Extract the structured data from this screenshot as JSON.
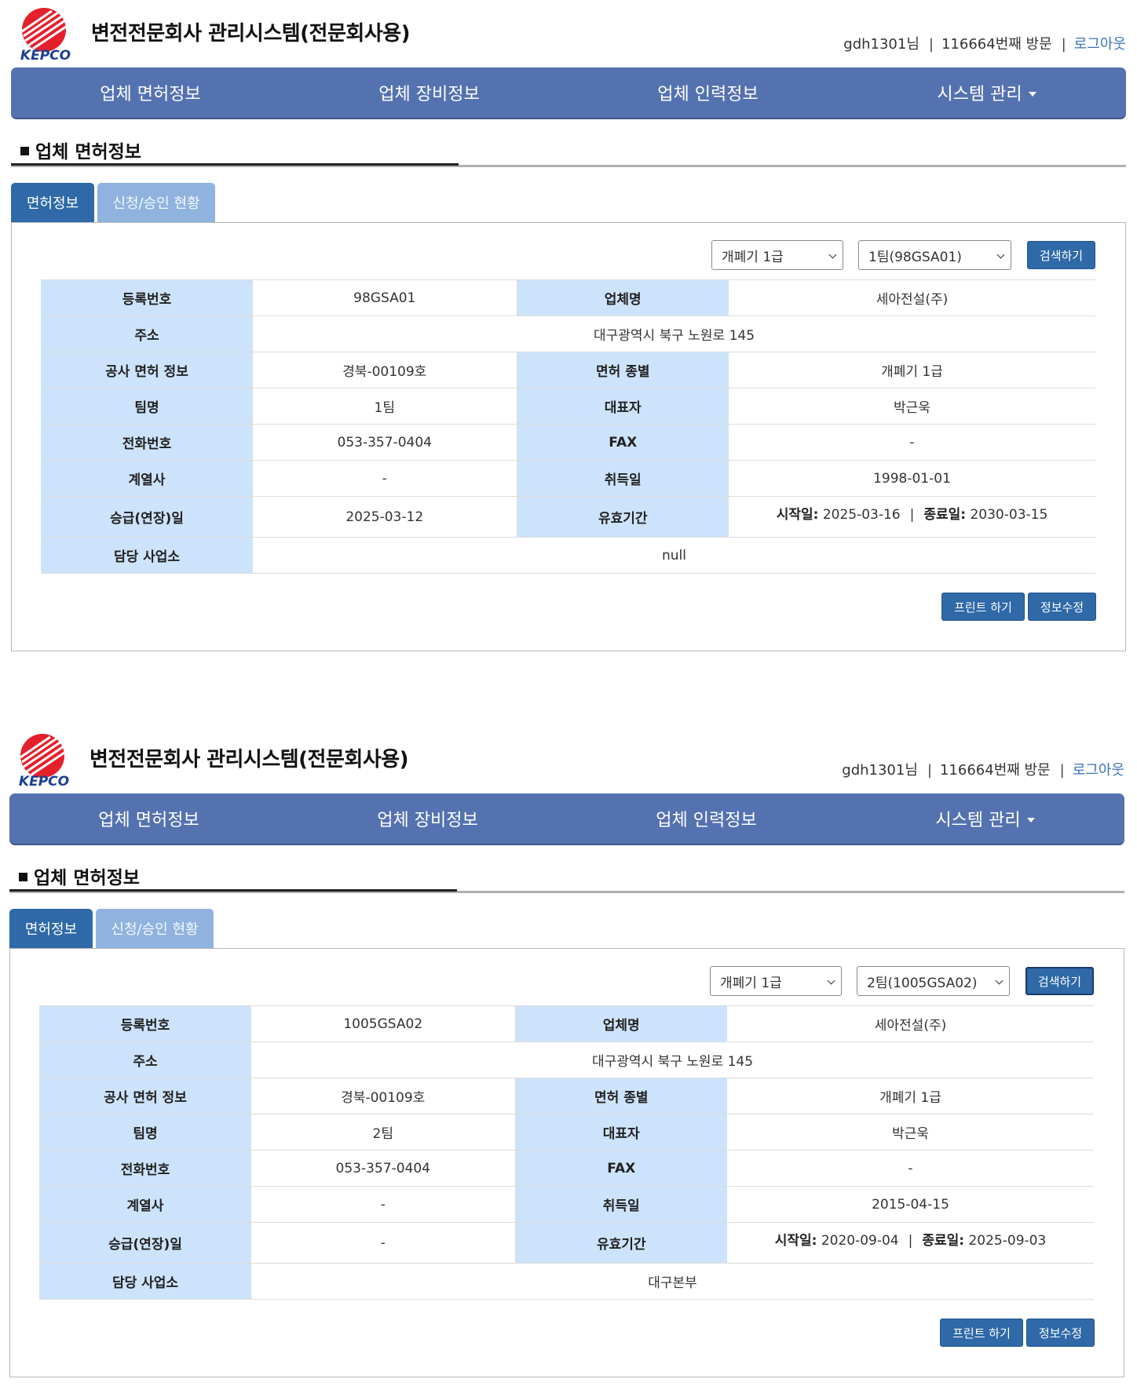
{
  "header": {
    "system_title": "변전전문회사 관리시스템(전문회사용)",
    "logo_text": "KEPCO",
    "user_name": "gdh1301님",
    "separator": "|",
    "visit_count": "116664번째 방문",
    "logout_label": "로그아웃"
  },
  "nav": {
    "items": [
      "업체 면허정보",
      "업체 장비정보",
      "업체 인력정보",
      "시스템 관리"
    ]
  },
  "section": {
    "title": "업체 면허정보"
  },
  "tabs": {
    "license": "면허정보",
    "status": "신청/승인 현황"
  },
  "buttons": {
    "search": "검색하기",
    "print": "프린트 하기",
    "edit": "정보수정"
  },
  "labels": {
    "reg_no": "등록번호",
    "company_name": "업체명",
    "address": "주소",
    "license_info": "공사 면허 정보",
    "license_type": "면허 종별",
    "team_name": "팀명",
    "ceo": "대표자",
    "phone": "전화번호",
    "fax": "FAX",
    "affiliate": "계열사",
    "acquire_date": "취득일",
    "promotion_date": "승급(연장)일",
    "validity": "유효기간",
    "office": "담당 사업소",
    "start_label": "시작일:",
    "end_label": "종료일:",
    "period_sep": "|"
  },
  "colors": {
    "nav": "#5572b0",
    "tab_active": "#2f69a8",
    "tab_inactive": "#8fb3de",
    "label_bg": "#cde3fb",
    "link": "#3a72b7"
  },
  "panels": [
    {
      "filter": {
        "grade": "개폐기 1급",
        "team": "1팀(98GSA01)"
      },
      "record": {
        "reg_no": "98GSA01",
        "company_name": "세아전설(주)",
        "address": "대구광역시 북구 노원로 145",
        "license_info": "경북-00109호",
        "license_type": "개폐기 1급",
        "team_name": "1팀",
        "ceo": "박근욱",
        "phone": "053-357-0404",
        "fax": "-",
        "affiliate": "-",
        "acquire_date": "1998-01-01",
        "promotion_date": "2025-03-12",
        "start_date": "2025-03-16",
        "end_date": "2030-03-15",
        "office": "null"
      }
    },
    {
      "filter": {
        "grade": "개폐기 1급",
        "team": "2팀(1005GSA02)"
      },
      "record": {
        "reg_no": "1005GSA02",
        "company_name": "세아전설(주)",
        "address": "대구광역시 북구 노원로 145",
        "license_info": "경북-00109호",
        "license_type": "개폐기 1급",
        "team_name": "2팀",
        "ceo": "박근욱",
        "phone": "053-357-0404",
        "fax": "-",
        "affiliate": "-",
        "acquire_date": "2015-04-15",
        "promotion_date": "-",
        "start_date": "2020-09-04",
        "end_date": "2025-09-03",
        "office": "대구본부"
      }
    }
  ]
}
